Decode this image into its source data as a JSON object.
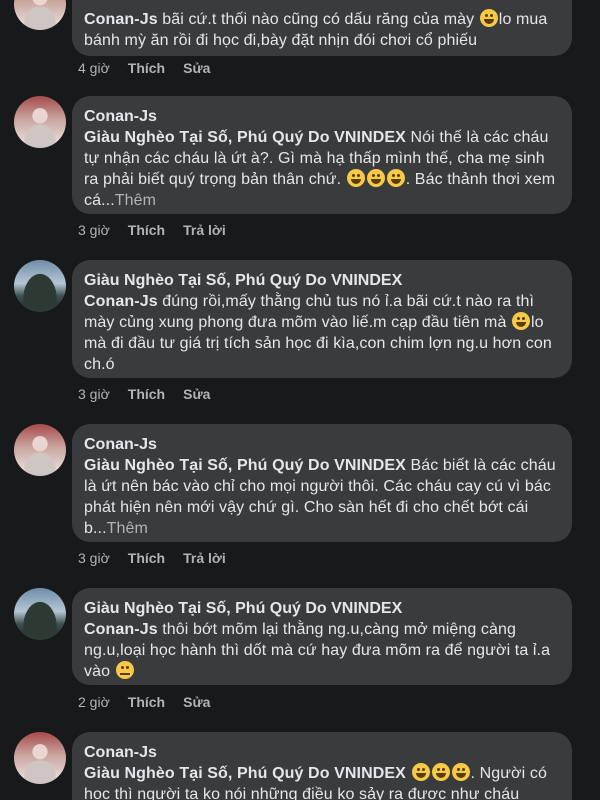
{
  "comments": [
    {
      "author": "Conan-Js",
      "mention": "",
      "text_before": "bãi cứ.t thối nào cũng có dấu răng của mày ",
      "text_after": "lo mua bánh mỳ ăn rồi đi học đi,bày đặt nhịn đói chơi cổ phiếu",
      "more": "",
      "time": "4 giờ",
      "like": "Thích",
      "action": "Sửa"
    },
    {
      "author": "Conan-Js",
      "mention": "Giàu Nghèo Tại Số, Phú Quý Do VNINDEX",
      "text_before": " Nói thế là các cháu tự nhận các cháu là ứt à?. Gì mà hạ thấp mình thế, cha mẹ sinh ra phải biết quý trọng bản thân chứ. ",
      "text_after": ". Bác thảnh thơi xem cá...",
      "more": "Thêm",
      "time": "3 giờ",
      "like": "Thích",
      "action": "Trả lời"
    },
    {
      "author": "Giàu Nghèo Tại Số, Phú Quý Do VNINDEX",
      "mention": "Conan-Js",
      "text_before": " đúng rồi,mấy thằng chủ tus nó ỉ.a bãi cứ.t nào ra thì mày củng xung phong đưa mõm vào liế.m cạp đầu tiên mà ",
      "text_after": "lo mà đi đầu tư giá trị tích sản học đi kìa,con chim lợn ng.u hơn con ch.ó",
      "more": "",
      "time": "3 giờ",
      "like": "Thích",
      "action": "Sửa"
    },
    {
      "author": "Conan-Js",
      "mention": "Giàu Nghèo Tại Số, Phú Quý Do VNINDEX",
      "text_before": " Bác biết là các cháu là ứt nên bác vào chỉ cho mọi người thôi. Các cháu cay cú vì bác phát hiện nên mới vậy chứ gì. Cho sàn hết đi cho chết bớt cái b...",
      "text_after": "",
      "more": "Thêm",
      "time": "3 giờ",
      "like": "Thích",
      "action": "Trả lời"
    },
    {
      "author": "Giàu Nghèo Tại Số, Phú Quý Do VNINDEX",
      "mention": "Conan-Js",
      "text_before": " thôi bớt mõm lại thằng ng.u,càng mở miệng càng ng.u,loại học hành thì dốt mà cứ hay đưa mõm ra để người ta ỉ.a vào ",
      "text_after": "",
      "more": "",
      "time": "2 giờ",
      "like": "Thích",
      "action": "Sửa"
    },
    {
      "author": "Conan-Js",
      "mention": "Giàu Nghèo Tại Số, Phú Quý Do VNINDEX",
      "text_before": " ",
      "text_after": ". Người có học thì người ta ko nói những điều ko sảy ra được như cháu",
      "more": "",
      "time": "",
      "like": "",
      "action": ""
    }
  ]
}
